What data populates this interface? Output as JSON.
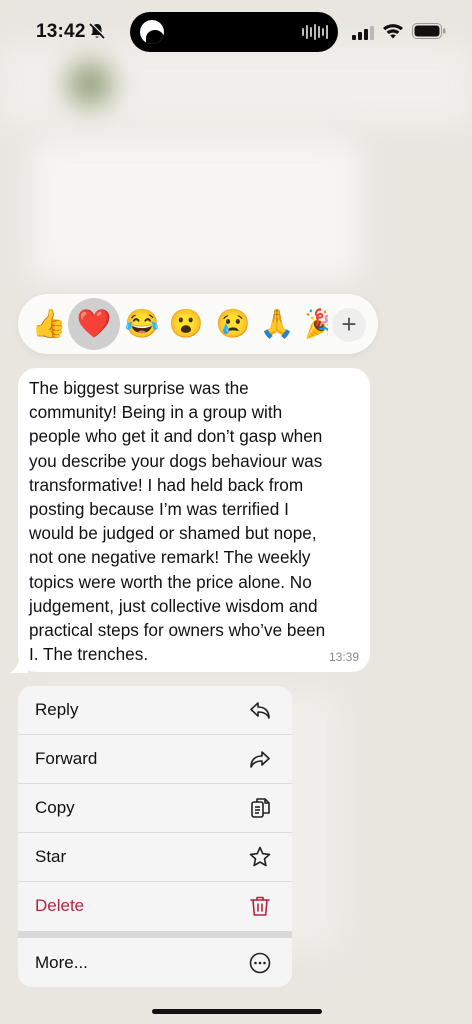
{
  "status_bar": {
    "time": "13:42"
  },
  "reactions": [
    {
      "icon": "thumbs-up",
      "glyph": "👍"
    },
    {
      "icon": "red-heart",
      "glyph": "❤️",
      "selected": true
    },
    {
      "icon": "tears-of-joy",
      "glyph": "😂"
    },
    {
      "icon": "surprised-face",
      "glyph": "😮"
    },
    {
      "icon": "crying-face",
      "glyph": "😢"
    },
    {
      "icon": "folded-hands",
      "glyph": "🙏"
    },
    {
      "icon": "party-popper",
      "glyph": "🎉"
    }
  ],
  "reaction_plus": "+",
  "message": {
    "text": "The biggest surprise was the\ncommunity! Being in a group with\npeople who get it and don’t gasp when\nyou describe your dogs behaviour was\ntransformative! I had held back from\nposting because I’m was terrified I\nwould be judged or shamed but nope,\nnot one negative remark! The weekly\ntopics were worth the price alone. No\njudgement, just collective wisdom and\npractical steps for owners who’ve been\nI. The trenches.",
    "time": "13:39"
  },
  "menu": {
    "items": [
      {
        "label": "Reply",
        "icon": "reply-icon"
      },
      {
        "label": "Forward",
        "icon": "forward-icon"
      },
      {
        "label": "Copy",
        "icon": "copy-icon"
      },
      {
        "label": "Star",
        "icon": "star-icon"
      },
      {
        "label": "Delete",
        "icon": "trash-icon"
      },
      {
        "label": "More...",
        "icon": "more-icon"
      }
    ]
  },
  "colors": {
    "delete": "#b3243f",
    "menu_bg": "#f5f5f5",
    "reaction_selected": "#cfcfcf"
  }
}
